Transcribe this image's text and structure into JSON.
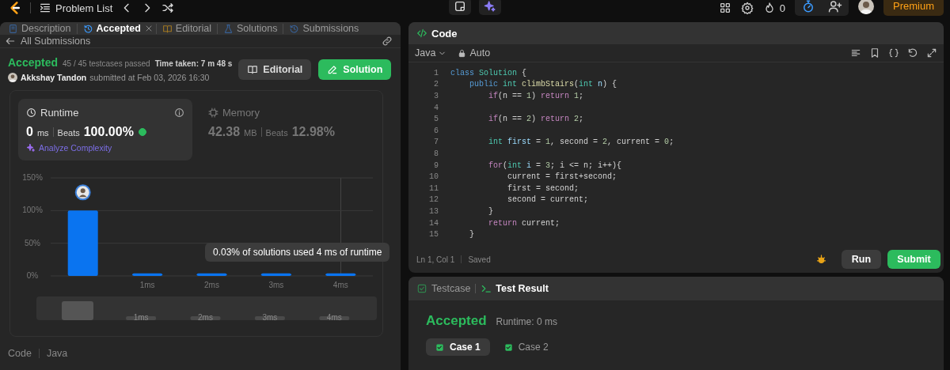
{
  "top_bar": {
    "title": "Problem List",
    "streak": "0",
    "premium": "Premium"
  },
  "left_tabs": [
    {
      "label": "Description",
      "selected": false,
      "closable": false
    },
    {
      "label": "Accepted",
      "selected": true,
      "closable": true
    },
    {
      "label": "Editorial",
      "selected": false,
      "closable": false
    },
    {
      "label": "Solutions",
      "selected": false,
      "closable": false
    },
    {
      "label": "Submissions",
      "selected": false,
      "closable": false
    }
  ],
  "submission": {
    "back": "All Submissions",
    "status": "Accepted",
    "tests": "45 / 45 testcases passed",
    "time": "Time taken: 7 m 48 s",
    "author": "Akkshay Tandon",
    "submitted": "submitted at Feb 03, 2026 16:30",
    "buttons": [
      {
        "label": "Editorial",
        "kind": "secondary"
      },
      {
        "label": "Solution",
        "kind": "primary"
      }
    ]
  },
  "stats": [
    {
      "label": "Runtime",
      "value": "0",
      "unit": "ms",
      "beats_label": "Beats",
      "beats": "100.00%",
      "selected": true
    },
    {
      "label": "Memory",
      "value": "42.38",
      "unit": "MB",
      "beats_label": "Beats",
      "beats": "12.98%",
      "selected": false
    }
  ],
  "analyze": "Analyze Complexity",
  "chart_data": {
    "type": "bar",
    "x": [
      0,
      1,
      2,
      3,
      4
    ],
    "values": [
      100,
      4,
      4,
      4,
      4
    ],
    "xlim": [
      -0.5,
      4.5
    ],
    "ylim": [
      0,
      150
    ],
    "yticks": [
      {
        "value": 0,
        "label": "0%"
      },
      {
        "value": 50,
        "label": "50%"
      },
      {
        "value": 100,
        "label": "100%"
      },
      {
        "value": 150,
        "label": "150%"
      }
    ],
    "xticks": [
      {
        "value": 1,
        "label": "1ms"
      },
      {
        "value": 2,
        "label": "2ms"
      },
      {
        "value": 3,
        "label": "3ms"
      },
      {
        "value": 4,
        "label": "4ms"
      }
    ]
  },
  "tooltip": "0.03% of solutions used 4 ms of runtime",
  "navigator_labels": [
    "1ms",
    "2ms",
    "3ms",
    "4ms"
  ],
  "code_footer": {
    "label": "Code",
    "language": "Java"
  },
  "editor": {
    "title": "Code",
    "language": "Java",
    "mode": "Auto",
    "status": "Ln 1, Col 1",
    "saved": "Saved",
    "run": "Run",
    "submit": "Submit",
    "lines": [
      {
        "n": "1",
        "segments": [
          {
            "kind": "keyword",
            "text": "class "
          },
          {
            "kind": "type",
            "text": "Solution"
          },
          {
            "kind": "plain",
            "text": " {"
          }
        ]
      },
      {
        "n": "2",
        "segments": [
          {
            "kind": "keyword",
            "text": "    public "
          },
          {
            "kind": "type",
            "text": "int "
          },
          {
            "kind": "function",
            "text": "climbStairs"
          },
          {
            "kind": "plain",
            "text": "("
          },
          {
            "kind": "type",
            "text": "int "
          },
          {
            "kind": "variable",
            "text": "n"
          },
          {
            "kind": "plain",
            "text": ") {"
          }
        ]
      },
      {
        "n": "3",
        "segments": [
          {
            "kind": "control",
            "text": "        if"
          },
          {
            "kind": "plain",
            "text": "(n == "
          },
          {
            "kind": "number",
            "text": "1"
          },
          {
            "kind": "plain",
            "text": ") "
          },
          {
            "kind": "control",
            "text": "return "
          },
          {
            "kind": "number",
            "text": "1"
          },
          {
            "kind": "plain",
            "text": ";"
          }
        ]
      },
      {
        "n": "4"
      },
      {
        "n": "5",
        "segments": [
          {
            "kind": "control",
            "text": "        if"
          },
          {
            "kind": "plain",
            "text": "(n == "
          },
          {
            "kind": "number",
            "text": "2"
          },
          {
            "kind": "plain",
            "text": ") "
          },
          {
            "kind": "control",
            "text": "return "
          },
          {
            "kind": "number",
            "text": "2"
          },
          {
            "kind": "plain",
            "text": ";"
          }
        ]
      },
      {
        "n": "6"
      },
      {
        "n": "7",
        "segments": [
          {
            "kind": "type",
            "text": "        int "
          },
          {
            "kind": "variable",
            "text": "first"
          },
          {
            "kind": "plain",
            "text": " = "
          },
          {
            "kind": "number",
            "text": "1"
          },
          {
            "kind": "plain",
            "text": ", second = "
          },
          {
            "kind": "number",
            "text": "2"
          },
          {
            "kind": "plain",
            "text": ", current = "
          },
          {
            "kind": "number",
            "text": "0"
          },
          {
            "kind": "plain",
            "text": ";"
          }
        ]
      },
      {
        "n": "8"
      },
      {
        "n": "9",
        "segments": [
          {
            "kind": "control",
            "text": "        for"
          },
          {
            "kind": "plain",
            "text": "("
          },
          {
            "kind": "type",
            "text": "int "
          },
          {
            "kind": "variable",
            "text": "i"
          },
          {
            "kind": "plain",
            "text": " = "
          },
          {
            "kind": "number",
            "text": "3"
          },
          {
            "kind": "plain",
            "text": "; i <= n; i++){"
          }
        ]
      },
      {
        "n": "10",
        "segments": [
          {
            "kind": "plain",
            "text": "            current = first+second;"
          }
        ]
      },
      {
        "n": "11",
        "segments": [
          {
            "kind": "plain",
            "text": "            first = second;"
          }
        ]
      },
      {
        "n": "12",
        "segments": [
          {
            "kind": "plain",
            "text": "            second = current;"
          }
        ]
      },
      {
        "n": "13",
        "segments": [
          {
            "kind": "plain",
            "text": "        }"
          }
        ]
      },
      {
        "n": "14",
        "segments": [
          {
            "kind": "control",
            "text": "        return"
          },
          {
            "kind": "plain",
            "text": " current;"
          }
        ]
      },
      {
        "n": "15",
        "segments": [
          {
            "kind": "plain",
            "text": "    }"
          }
        ]
      }
    ]
  },
  "result": {
    "tabs": [
      {
        "label": "Testcase",
        "selected": false
      },
      {
        "label": "Test Result",
        "selected": true
      }
    ],
    "status": "Accepted",
    "runtime": "Runtime: 0 ms",
    "cases": [
      {
        "label": "Case 1",
        "selected": true,
        "passed": true
      },
      {
        "label": "Case 2",
        "selected": false,
        "passed": true
      }
    ]
  }
}
